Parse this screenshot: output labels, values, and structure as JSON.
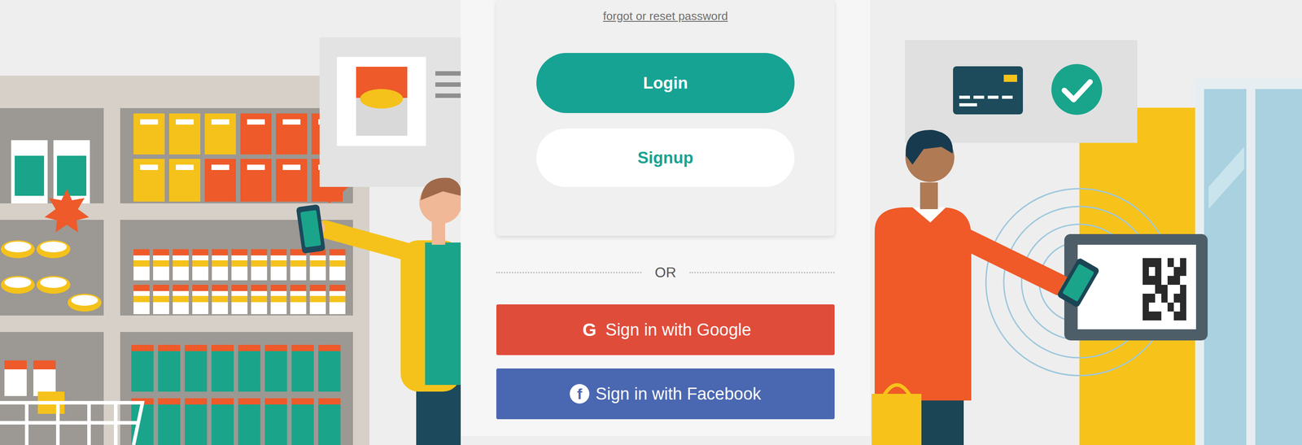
{
  "login_panel": {
    "forgot_link": "forgot or reset password",
    "login_button": "Login",
    "signup_button": "Signup"
  },
  "divider": "OR",
  "social_buttons": [
    {
      "icon": "G",
      "label": "Sign in with Google",
      "color": "#e04c3a"
    },
    {
      "icon": "f",
      "label": "Sign in with Facebook",
      "color": "#4a67b1"
    }
  ]
}
